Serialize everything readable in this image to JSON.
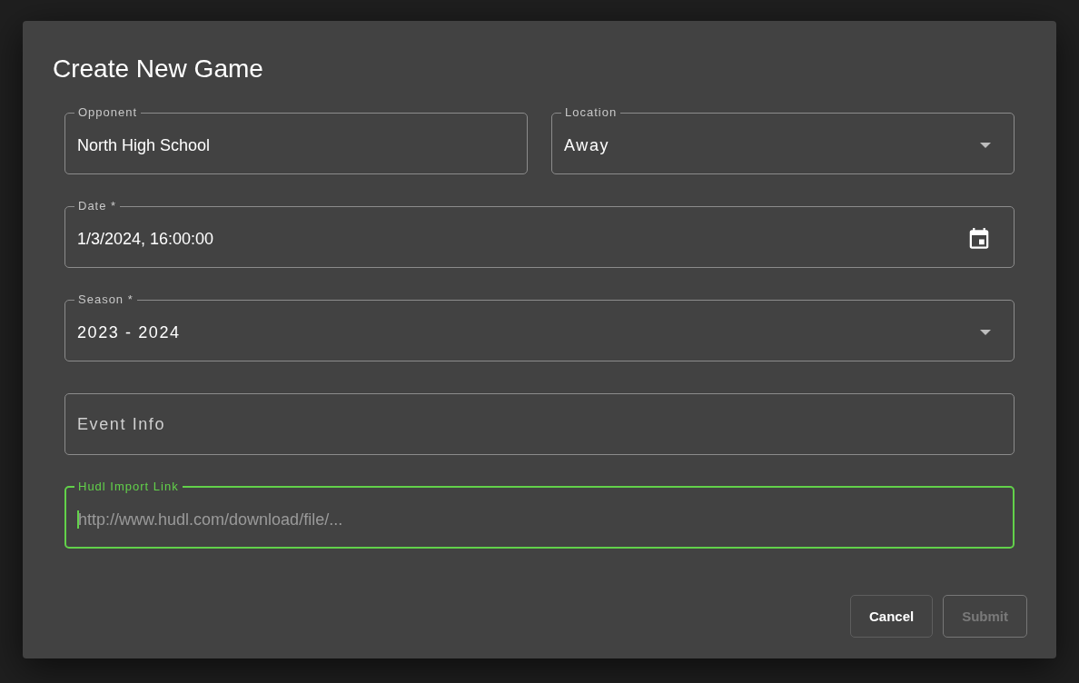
{
  "dialog": {
    "title": "Create New Game",
    "rows": [
      {
        "fields": [
          {
            "kind": "text",
            "label": "Opponent",
            "value": "North High School",
            "focused": false
          },
          {
            "kind": "select",
            "label": "Location",
            "value": "Away",
            "focused": false
          }
        ]
      },
      {
        "fields": [
          {
            "kind": "date",
            "label": "Date *",
            "value": "1/3/2024, 16:00:00",
            "focused": false
          }
        ]
      },
      {
        "fields": [
          {
            "kind": "select",
            "label": "Season *",
            "value": "2023 - 2024",
            "focused": false
          }
        ]
      },
      {
        "fields": [
          {
            "kind": "text",
            "label": "Event Info",
            "focused": false
          }
        ]
      },
      {
        "fields": [
          {
            "kind": "text",
            "label": "Hudl Import Link",
            "placeholder": "http://www.hudl.com/download/file/...",
            "focused": true
          }
        ]
      }
    ],
    "buttons": [
      {
        "label": "Cancel",
        "disabled": false
      },
      {
        "label": "Submit",
        "disabled": true
      }
    ]
  }
}
